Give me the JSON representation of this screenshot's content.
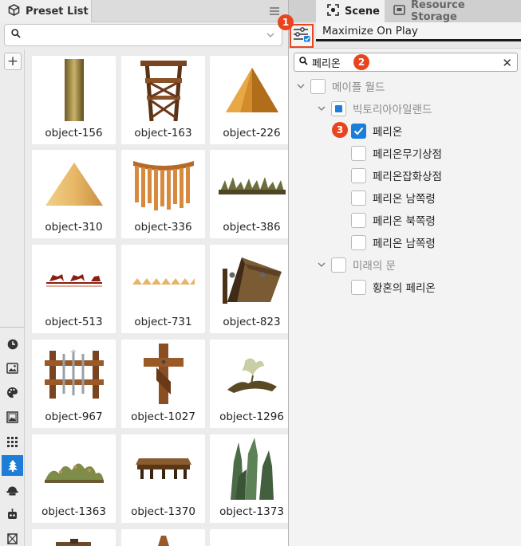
{
  "left_panel": {
    "tab_title": "Preset List",
    "search": {
      "value": "",
      "placeholder": ""
    },
    "add_label": "+",
    "sidebar_icons": [
      "clock-icon",
      "image-icon",
      "palette-icon",
      "picture-frame-icon",
      "grid-icon",
      "tree-icon",
      "robot-hat-icon",
      "robot-icon",
      "flag-icon"
    ],
    "presets": [
      "object-156",
      "object-163",
      "object-226",
      "object-310",
      "object-336",
      "object-386",
      "object-513",
      "object-731",
      "object-823",
      "object-967",
      "object-1027",
      "object-1296",
      "object-1363",
      "object-1370",
      "object-1373"
    ]
  },
  "right_panel": {
    "tabs": [
      {
        "label": "Scene",
        "icon": "scene-icon",
        "active": true
      },
      {
        "label": "Resource Storage",
        "icon": "storage-icon",
        "active": false
      }
    ],
    "maximize_on_play": "Maximize On Play",
    "hierarchy_search": {
      "value": "페리온",
      "clear": "✕"
    },
    "tree": [
      {
        "label": "메이플 월드",
        "level": 0,
        "expanded": true,
        "state": "unchecked",
        "dim": true
      },
      {
        "label": "빅토리아아일랜드",
        "level": 1,
        "expanded": true,
        "state": "indeterminate",
        "dim": true
      },
      {
        "label": "페리온",
        "level": 2,
        "state": "checked",
        "dim": false
      },
      {
        "label": "페리온무기상점",
        "level": 2,
        "state": "unchecked",
        "dim": false
      },
      {
        "label": "페리온잡화상점",
        "level": 2,
        "state": "unchecked",
        "dim": false
      },
      {
        "label": "페리온 남쪽령",
        "level": 2,
        "state": "unchecked",
        "dim": false
      },
      {
        "label": "페리온 북쪽령",
        "level": 2,
        "state": "unchecked",
        "dim": false
      },
      {
        "label": "페리온 남쪽령",
        "level": 2,
        "state": "unchecked",
        "dim": false
      },
      {
        "label": "미래의 문",
        "level": 1,
        "expanded": true,
        "state": "unchecked",
        "dim": true
      },
      {
        "label": "황혼의 페리온",
        "level": 2,
        "state": "unchecked",
        "dim": false
      }
    ],
    "callouts": [
      "1",
      "2",
      "3"
    ]
  },
  "colors": {
    "accent": "#1c7ed6",
    "callout": "#e8451f"
  }
}
